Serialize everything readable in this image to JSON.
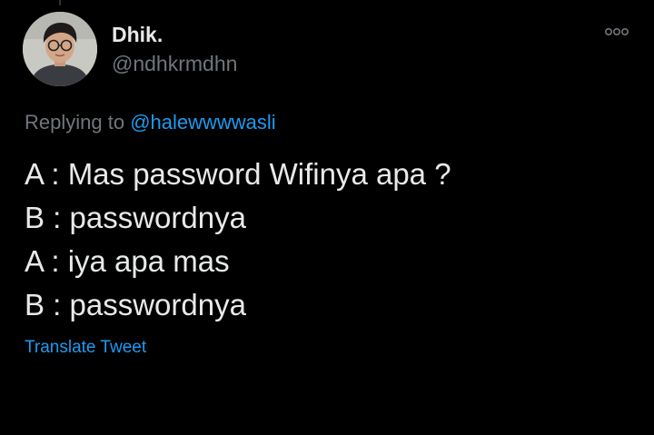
{
  "tweet": {
    "author": {
      "display_name": "Dhik.",
      "handle": "@ndhkrmdhn",
      "avatar_icon": "user-avatar"
    },
    "more_icon": "more-horizontal-icon",
    "replying_to": {
      "prefix": "Replying to",
      "mention": "@halewwwwasli"
    },
    "lines": [
      "A : Mas password Wifinya apa ?",
      "B : passwordnya",
      "A : iya apa mas",
      "B : passwordnya"
    ],
    "translate_label": "Translate Tweet"
  },
  "colors": {
    "background": "#000000",
    "text_primary": "#e7e9ea",
    "text_secondary": "#71767b",
    "accent": "#1d9bf0"
  }
}
